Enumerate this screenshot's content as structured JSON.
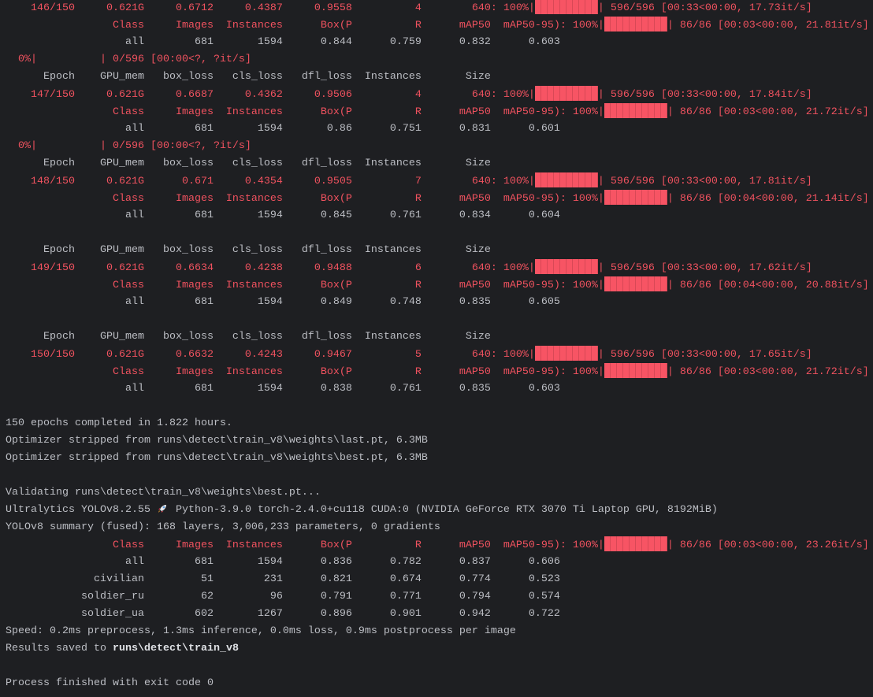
{
  "colors": {
    "red": "#f0525f",
    "text": "#bcbec4",
    "bar": "#f75464",
    "background": "#1e1f22"
  },
  "train_headers": [
    "Epoch",
    "GPU_mem",
    "box_loss",
    "cls_loss",
    "dfl_loss",
    "Instances",
    "Size"
  ],
  "val_headers": [
    "Class",
    "Images",
    "Instances",
    "Box(P",
    "R",
    "mAP50",
    "mAP50-95)"
  ],
  "zero_progress": "  0%|          | 0/596 [00:00<?, ?it/s]",
  "epochs": [
    {
      "cells": [
        "146/150",
        "0.621G",
        "0.6712",
        "0.4387",
        "0.9558",
        "4",
        "640"
      ],
      "train_progress": {
        "percent": 100,
        "tail": "596/596 [00:33<00:00, 17.73it/s]"
      },
      "val_progress": {
        "percent": 100,
        "tail": "86/86 [00:03<00:00, 21.81it/s]"
      },
      "val": [
        "all",
        "681",
        "1594",
        "0.844",
        "0.759",
        "0.832",
        "0.603"
      ],
      "header_before": false,
      "after": "zero"
    },
    {
      "cells": [
        "147/150",
        "0.621G",
        "0.6687",
        "0.4362",
        "0.9506",
        "4",
        "640"
      ],
      "train_progress": {
        "percent": 100,
        "tail": "596/596 [00:33<00:00, 17.84it/s]"
      },
      "val_progress": {
        "percent": 100,
        "tail": "86/86 [00:03<00:00, 21.72it/s]"
      },
      "val": [
        "all",
        "681",
        "1594",
        "0.86",
        "0.751",
        "0.831",
        "0.601"
      ],
      "header_before": true,
      "after": "zero"
    },
    {
      "cells": [
        "148/150",
        "0.621G",
        "0.671",
        "0.4354",
        "0.9505",
        "7",
        "640"
      ],
      "train_progress": {
        "percent": 100,
        "tail": "596/596 [00:33<00:00, 17.81it/s]"
      },
      "val_progress": {
        "percent": 100,
        "tail": "86/86 [00:04<00:00, 21.14it/s]"
      },
      "val": [
        "all",
        "681",
        "1594",
        "0.845",
        "0.761",
        "0.834",
        "0.604"
      ],
      "header_before": true,
      "after": "blank"
    },
    {
      "cells": [
        "149/150",
        "0.621G",
        "0.6634",
        "0.4238",
        "0.9488",
        "6",
        "640"
      ],
      "train_progress": {
        "percent": 100,
        "tail": "596/596 [00:33<00:00, 17.62it/s]"
      },
      "val_progress": {
        "percent": 100,
        "tail": "86/86 [00:04<00:00, 20.88it/s]"
      },
      "val": [
        "all",
        "681",
        "1594",
        "0.849",
        "0.748",
        "0.835",
        "0.605"
      ],
      "header_before": true,
      "after": "blank"
    },
    {
      "cells": [
        "150/150",
        "0.621G",
        "0.6632",
        "0.4243",
        "0.9467",
        "5",
        "640"
      ],
      "train_progress": {
        "percent": 100,
        "tail": "596/596 [00:33<00:00, 17.65it/s]"
      },
      "val_progress": {
        "percent": 100,
        "tail": "86/86 [00:03<00:00, 21.72it/s]"
      },
      "val": [
        "all",
        "681",
        "1594",
        "0.838",
        "0.761",
        "0.835",
        "0.603"
      ],
      "header_before": true,
      "after": "blank"
    }
  ],
  "summary": {
    "completed": "150 epochs completed in 1.822 hours.",
    "stripped_last": "Optimizer stripped from runs\\detect\\train_v8\\weights\\last.pt, 6.3MB",
    "stripped_best": "Optimizer stripped from runs\\detect\\train_v8\\weights\\best.pt, 6.3MB",
    "validating": "Validating runs\\detect\\train_v8\\weights\\best.pt...",
    "ultralytics_before": "Ultralytics YOLOv8.2.55 ",
    "ultralytics_after": " Python-3.9.0 torch-2.4.0+cu118 CUDA:0 (NVIDIA GeForce RTX 3070 Ti Laptop GPU, 8192MiB)",
    "model_summary": "YOLOv8 summary (fused): 168 layers, 3,006,233 parameters, 0 gradients",
    "final_val_progress": {
      "percent": 100,
      "tail": "86/86 [00:03<00:00, 23.26it/s]"
    },
    "final_rows": [
      [
        "all",
        "681",
        "1594",
        "0.836",
        "0.782",
        "0.837",
        "0.606"
      ],
      [
        "civilian",
        "51",
        "231",
        "0.821",
        "0.674",
        "0.774",
        "0.523"
      ],
      [
        "soldier_ru",
        "62",
        "96",
        "0.791",
        "0.771",
        "0.794",
        "0.574"
      ],
      [
        "soldier_ua",
        "602",
        "1267",
        "0.896",
        "0.901",
        "0.942",
        "0.722"
      ]
    ],
    "speed": "Speed: 0.2ms preprocess, 1.3ms inference, 0.0ms loss, 0.9ms postprocess per image",
    "results_prefix": "Results saved to ",
    "results_path": "runs\\detect\\train_v8",
    "exit": "Process finished with exit code 0"
  }
}
